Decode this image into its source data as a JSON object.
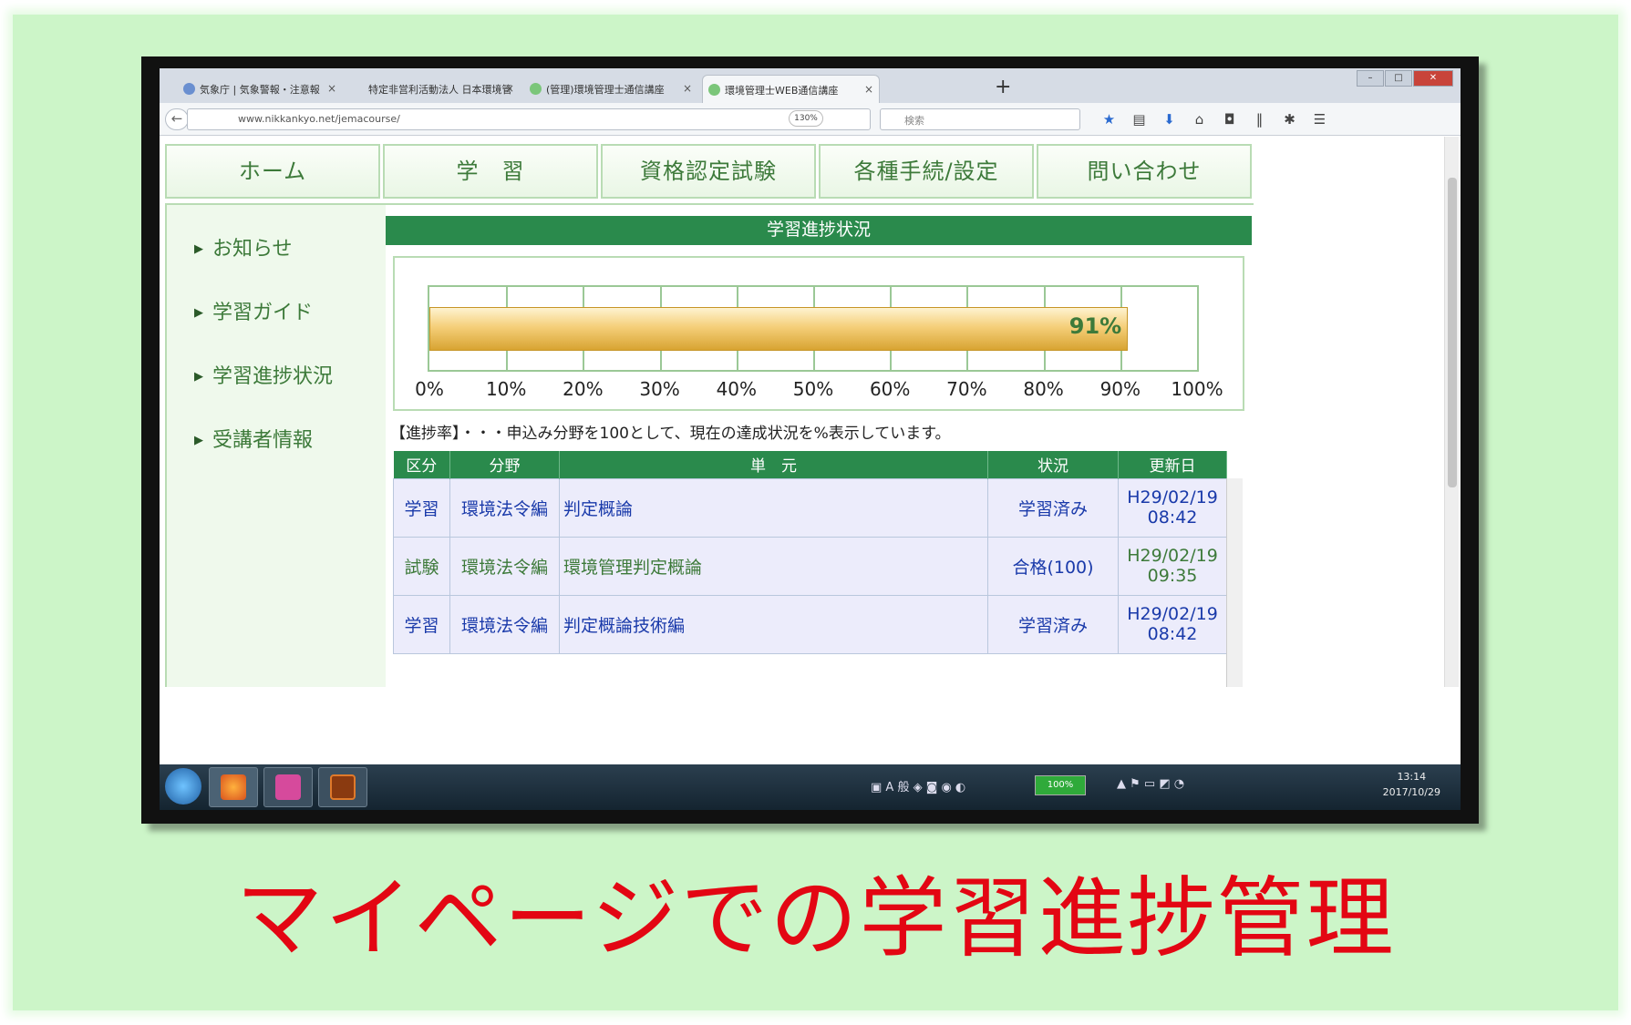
{
  "tabs": [
    {
      "label": "気象庁 | 気象警報・注意報"
    },
    {
      "label": "特定非営利活動法人 日本環境管"
    },
    {
      "label": "(管理)環境管理士通信講座"
    },
    {
      "label": "環境管理士WEB通信講座",
      "active": true
    }
  ],
  "url": "www.nikkankyo.net/jemacourse/",
  "zoom": "130%",
  "search_placeholder": "検索",
  "menu": [
    "ホーム",
    "学　習",
    "資格認定試験",
    "各種手続/設定",
    "問い合わせ"
  ],
  "sidebar": [
    "お知らせ",
    "学習ガイド",
    "学習進捗状況",
    "受講者情報"
  ],
  "section_title": "学習進捗状況",
  "progress": {
    "value": 91,
    "label": "91%",
    "ticks": [
      "0%",
      "10%",
      "20%",
      "30%",
      "40%",
      "50%",
      "60%",
      "70%",
      "80%",
      "90%",
      "100%"
    ]
  },
  "note": "【進捗率】・・・申込み分野を100として、現在の達成状況を%表示しています。",
  "table": {
    "headers": [
      "区分",
      "分野",
      "単　元",
      "状況",
      "更新日"
    ],
    "rows": [
      {
        "kind": "学習",
        "field": "環境法令編",
        "unit": "判定概論",
        "status": "学習済み",
        "date": "H29/02/19",
        "time": "08:42"
      },
      {
        "kind": "試験",
        "field": "環境法令編",
        "unit": "環境管理判定概論",
        "status": "合格(100)",
        "date": "H29/02/19",
        "time": "09:35"
      },
      {
        "kind": "学習",
        "field": "環境法令編",
        "unit": "判定概論技術編",
        "status": "学習済み",
        "date": "H29/02/19",
        "time": "08:42"
      }
    ]
  },
  "taskbar": {
    "battery": "100%",
    "time": "13:14",
    "date": "2017/10/29"
  },
  "caption": "マイページでの学習進捗管理",
  "colors": {
    "header_green": "#2a8a4c",
    "caption_red": "#e30613",
    "background_green": "#ccf5c8"
  }
}
